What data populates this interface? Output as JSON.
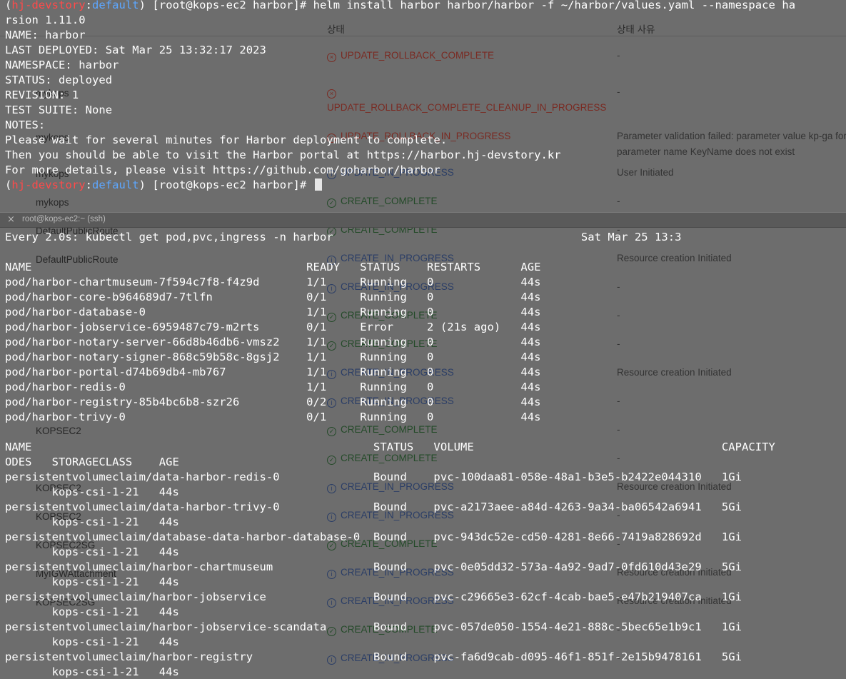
{
  "background_table": {
    "headers": {
      "name": "",
      "status": "상태",
      "reason": "상태 사유"
    },
    "top_rows": [
      {
        "name": "",
        "status": "UPDATE_ROLLBACK_COMPLETE",
        "kind": "failed",
        "reason": "-"
      },
      {
        "name": "mykops",
        "status": "UPDATE_ROLLBACK_COMPLETE_CLEANUP_IN_PROGRESS",
        "kind": "failed",
        "reason": "-"
      },
      {
        "name": "mykops",
        "status": "UPDATE_ROLLBACK_IN_PROGRESS",
        "kind": "failed",
        "reason": "Parameter validation failed: parameter value kp-ga for parameter name KeyName does not exist"
      },
      {
        "name": "mykops",
        "status": "UPDATE_IN_PROGRESS",
        "kind": "progress",
        "reason": "User Initiated"
      },
      {
        "name": "mykops",
        "status": "CREATE_COMPLETE",
        "kind": "complete",
        "reason": "-"
      }
    ],
    "bottom_rows": [
      {
        "name": "DefaultPublicRoute",
        "status": "CREATE_COMPLETE",
        "kind": "complete",
        "reason": "-"
      },
      {
        "name": "DefaultPublicRoute",
        "status": "CREATE_IN_PROGRESS",
        "kind": "progress",
        "reason": "Resource creation Initiated"
      },
      {
        "name": "",
        "status": "CREATE_IN_PROGRESS",
        "kind": "progress",
        "reason": "-"
      },
      {
        "name": "",
        "status": "CREATE_COMPLETE",
        "kind": "complete",
        "reason": "-"
      },
      {
        "name": "",
        "status": "CREATE_COMPLETE",
        "kind": "complete",
        "reason": "-"
      },
      {
        "name": "",
        "status": "CREATE_IN_PROGRESS",
        "kind": "progress",
        "reason": "Resource creation Initiated"
      },
      {
        "name": "",
        "status": "CREATE_IN_PROGRESS",
        "kind": "progress",
        "reason": "-"
      },
      {
        "name": "KOPSEC2",
        "status": "CREATE_COMPLETE",
        "kind": "complete",
        "reason": "-"
      },
      {
        "name": "",
        "status": "CREATE_COMPLETE",
        "kind": "complete",
        "reason": "-"
      },
      {
        "name": "KOPSEC2",
        "status": "CREATE_IN_PROGRESS",
        "kind": "progress",
        "reason": "Resource creation Initiated"
      },
      {
        "name": "KOPSEC2",
        "status": "CREATE_IN_PROGRESS",
        "kind": "progress",
        "reason": "-"
      },
      {
        "name": "KOPSEC2SG",
        "status": "CREATE_COMPLETE",
        "kind": "complete",
        "reason": "-"
      },
      {
        "name": "MyIGWAttachment",
        "status": "CREATE_IN_PROGRESS",
        "kind": "progress",
        "reason": "Resource creation Initiated"
      },
      {
        "name": "KOPSEC2SG",
        "status": "CREATE_IN_PROGRESS",
        "kind": "progress",
        "reason": "Resource creation Initiated"
      },
      {
        "name": "",
        "status": "CREATE_COMPLETE",
        "kind": "complete",
        "reason": "-"
      },
      {
        "name": "",
        "status": "CREATE_IN_PROGRESS",
        "kind": "progress",
        "reason": "-"
      }
    ]
  },
  "top_terminal": {
    "lines": [
      {
        "parts": [
          {
            "t": "(",
            "c": "plain"
          },
          {
            "t": "hj-devstory",
            "c": "user"
          },
          {
            "t": ":",
            "c": "plain"
          },
          {
            "t": "default",
            "c": "profile"
          },
          {
            "t": ") [root@kops-ec2 harbor]# helm install harbor harbor/harbor -f ~/harbor/values.yaml --namespace ha",
            "c": "plain"
          }
        ]
      },
      {
        "parts": [
          {
            "t": "rsion 1.11.0",
            "c": "plain"
          }
        ]
      },
      {
        "parts": [
          {
            "t": "NAME: harbor",
            "c": "plain"
          }
        ]
      },
      {
        "parts": [
          {
            "t": "LAST DEPLOYED: Sat Mar 25 13:32:17 2023",
            "c": "plain"
          }
        ]
      },
      {
        "parts": [
          {
            "t": "NAMESPACE: harbor",
            "c": "plain"
          }
        ]
      },
      {
        "parts": [
          {
            "t": "STATUS: deployed",
            "c": "plain"
          }
        ]
      },
      {
        "parts": [
          {
            "t": "REVISION: 1",
            "c": "plain"
          }
        ]
      },
      {
        "parts": [
          {
            "t": "TEST SUITE: None",
            "c": "plain"
          }
        ]
      },
      {
        "parts": [
          {
            "t": "NOTES:",
            "c": "plain"
          }
        ]
      },
      {
        "parts": [
          {
            "t": "Please wait for several minutes for Harbor deployment to complete.",
            "c": "plain"
          }
        ]
      },
      {
        "parts": [
          {
            "t": "Then you should be able to visit the Harbor portal at https://harbor.hj-devstory.kr",
            "c": "plain"
          }
        ]
      },
      {
        "parts": [
          {
            "t": "For more details, please visit https://github.com/goharbor/harbor",
            "c": "plain"
          }
        ]
      },
      {
        "parts": [
          {
            "t": "(",
            "c": "plain"
          },
          {
            "t": "hj-devstory",
            "c": "user"
          },
          {
            "t": ":",
            "c": "plain"
          },
          {
            "t": "default",
            "c": "profile"
          },
          {
            "t": ") [root@kops-ec2 harbor]# ",
            "c": "plain"
          }
        ],
        "cursor": true
      }
    ]
  },
  "divider": {
    "close_icon": "×",
    "title": "root@kops-ec2:~ (ssh)"
  },
  "bottom_terminal": {
    "lines": [
      "Every 2.0s: kubectl get pod,pvc,ingress -n harbor                                     Sat Mar 25 13:3",
      "",
      "NAME                                         READY   STATUS    RESTARTS      AGE",
      "pod/harbor-chartmuseum-7f594c7f8-f4z9d       1/1     Running   0             44s",
      "pod/harbor-core-b964689d7-7tlfn              0/1     Running   0             44s",
      "pod/harbor-database-0                        1/1     Running   0             44s",
      "pod/harbor-jobservice-6959487c79-m2rts       0/1     Error     2 (21s ago)   44s",
      "pod/harbor-notary-server-66d8b46db6-vmsz2    1/1     Running   0             44s",
      "pod/harbor-notary-signer-868c59b58c-8gsj2    1/1     Running   0             44s",
      "pod/harbor-portal-d74b69db4-mb767            1/1     Running   0             44s",
      "pod/harbor-redis-0                           1/1     Running   0             44s",
      "pod/harbor-registry-85b4bc6b8-szr26          0/2     Running   0             44s",
      "pod/harbor-trivy-0                           0/1     Running   0             44s",
      "",
      "NAME                                                   STATUS   VOLUME                                     CAPACITY",
      "ODES   STORAGECLASS    AGE",
      "persistentvolumeclaim/data-harbor-redis-0              Bound    pvc-100daa81-058e-48a1-b3e5-b2422e044310   1Gi",
      "       kops-csi-1-21   44s",
      "persistentvolumeclaim/data-harbor-trivy-0              Bound    pvc-a2173aee-a84d-4263-9a34-ba06542a6941   5Gi",
      "       kops-csi-1-21   44s",
      "persistentvolumeclaim/database-data-harbor-database-0  Bound    pvc-943dc52e-cd50-4281-8e66-7419a828692d   1Gi",
      "       kops-csi-1-21   44s",
      "persistentvolumeclaim/harbor-chartmuseum               Bound    pvc-0e05dd32-573a-4a92-9ad7-0fd610d43e29   5Gi",
      "       kops-csi-1-21   44s",
      "persistentvolumeclaim/harbor-jobservice                Bound    pvc-c29665e3-62cf-4cab-bae5-e47b219407ca   1Gi",
      "       kops-csi-1-21   44s",
      "persistentvolumeclaim/harbor-jobservice-scandata       Bound    pvc-057de050-1554-4e21-888c-5bec65e1b9c1   1Gi",
      "       kops-csi-1-21   44s",
      "persistentvolumeclaim/harbor-registry                  Bound    pvc-fa6d9cab-d095-46f1-851f-2e15b9478161   5Gi",
      "       kops-csi-1-21   44s"
    ]
  },
  "colors": {
    "terminal_text": "#ffffff",
    "user": "#ff4a4a",
    "profile": "#5da7ff",
    "failed": "#7a2a22",
    "complete": "#244a29",
    "progress": "#2a3d66"
  }
}
